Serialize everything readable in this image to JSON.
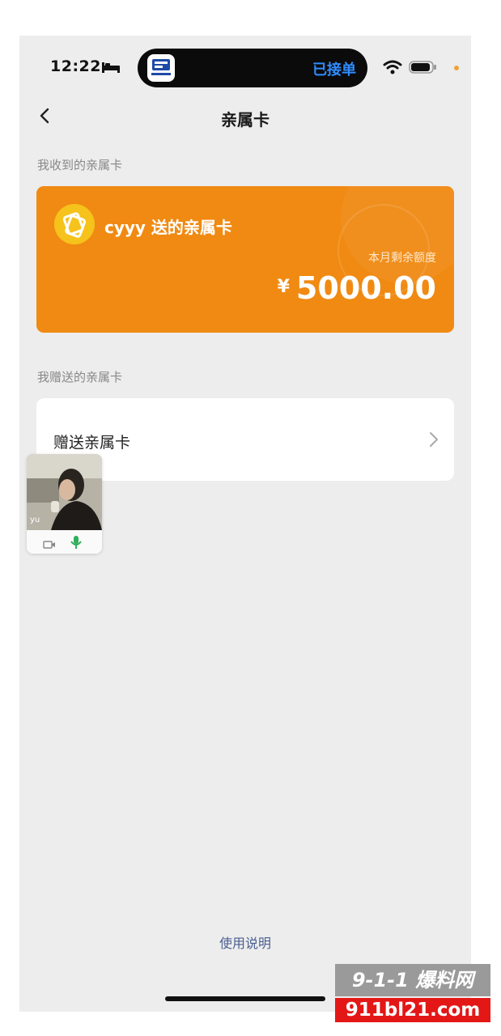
{
  "status_bar": {
    "time": "12:22",
    "island_status": "已接单"
  },
  "nav": {
    "title": "亲属卡"
  },
  "received_section": {
    "label": "我收到的亲属卡"
  },
  "card": {
    "title": "cyyy 送的亲属卡",
    "subtitle": "本月剩余额度",
    "currency": "¥",
    "amount": "5000.00",
    "color": "#f08a12"
  },
  "gifted_section": {
    "label": "我赠送的亲属卡"
  },
  "gift_row": {
    "label": "赠送亲属卡"
  },
  "pip": {
    "name": "yu"
  },
  "footer": {
    "link": "使用说明"
  },
  "watermark": {
    "top": "9-1-1 爆料网",
    "bottom": "911bl21.com"
  }
}
